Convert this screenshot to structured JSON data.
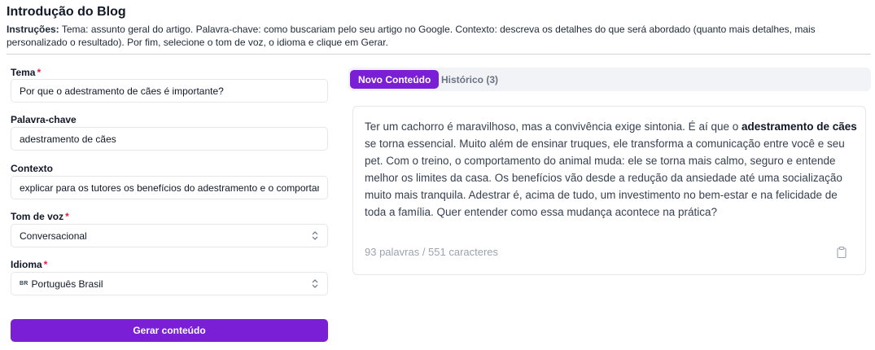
{
  "header": {
    "title": "Introdução do Blog",
    "instructions_label": "Instruções:",
    "instructions_text": "Tema: assunto geral do artigo. Palavra-chave: como buscariam pelo seu artigo no Google. Contexto: descreva os detalhes do que será abordado (quanto mais detalhes, mais personalizado o resultado). Por fim, selecione o tom de voz, o idioma e clique em Gerar."
  },
  "form": {
    "required_mark": "*",
    "tema": {
      "label": "Tema",
      "value": "Por que o adestramento de cães é importante?"
    },
    "palavra_chave": {
      "label": "Palavra-chave",
      "value": "adestramento de cães"
    },
    "contexto": {
      "label": "Contexto",
      "value": "explicar para os tutores os benefícios do adestramento e o comportamento"
    },
    "tom_de_voz": {
      "label": "Tom de voz",
      "value": "Conversacional"
    },
    "idioma": {
      "label": "Idioma",
      "flag": "BR",
      "value": "Português Brasil"
    },
    "submit_label": "Gerar conteúdo"
  },
  "tabs": {
    "new_label": "Novo Conteúdo",
    "history_label": "Histórico (3)"
  },
  "result": {
    "text_before": "Ter um cachorro é maravilhoso, mas a convivência exige sintonia. É aí que o ",
    "text_bold": "adestramento de cães",
    "text_after": " se torna essencial. Muito além de ensinar truques, ele transforma a comunicação entre você e seu pet. Com o treino, o comportamento do animal muda: ele se torna mais calmo, seguro e entende melhor os limites da casa. Os benefícios vão desde a redução da ansiedade até uma socialização muito mais tranquila. Adestrar é, acima de tudo, um investimento no bem-estar e na felicidade de toda a família. Quer entender como essa mudança acontece na prática?",
    "counts": "93 palavras / 551 caracteres",
    "copy_icon": "clipboard-icon"
  },
  "colors": {
    "accent": "#7b1fd6",
    "required": "#e11d48",
    "muted": "#9ca3af"
  }
}
